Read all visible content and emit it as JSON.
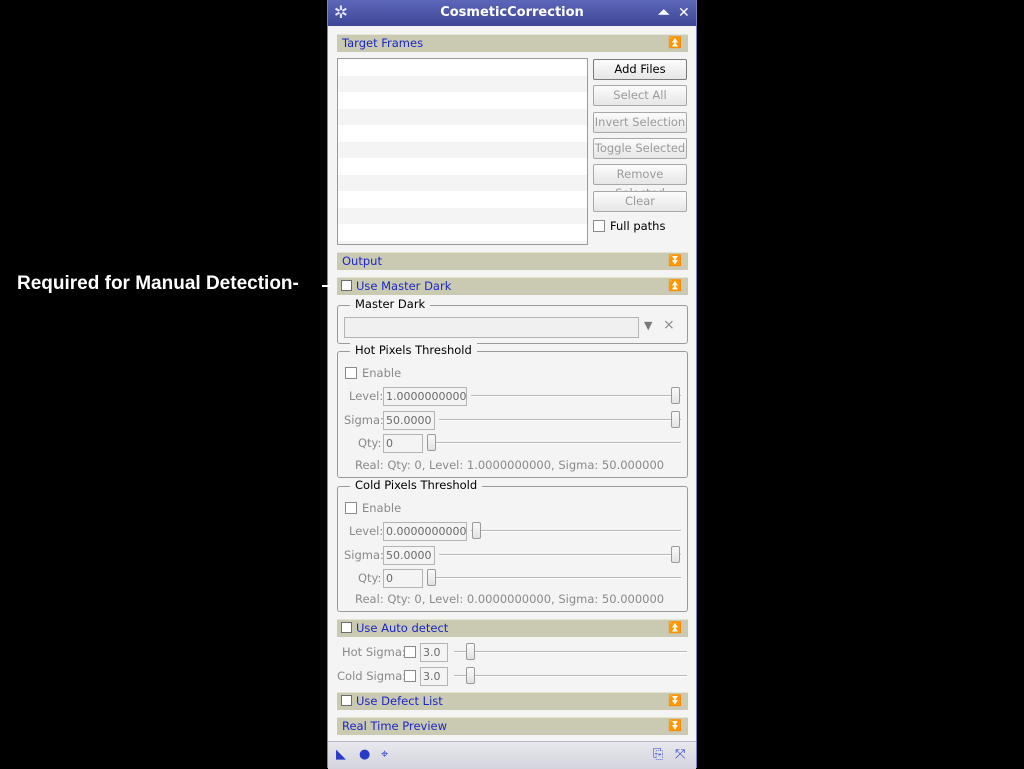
{
  "annotation": {
    "text": "Required for Manual Detection-"
  },
  "window": {
    "title": "CosmeticCorrection",
    "icons": {
      "menu": "gear-icon",
      "shade": "shade-up-icon",
      "close": "close-icon"
    }
  },
  "target_frames": {
    "header": "Target Frames",
    "buttons": {
      "add_files": "Add Files",
      "select_all": "Select All",
      "invert_selection": "Invert Selection",
      "toggle_selected": "Toggle Selected",
      "remove_selected": "Remove Selected",
      "clear": "Clear"
    },
    "full_paths": "Full paths"
  },
  "output": {
    "header": "Output"
  },
  "master_dark_section": {
    "header": "Use Master Dark",
    "master_dark_group": {
      "title": "Master Dark",
      "path_value": ""
    },
    "hot": {
      "title": "Hot Pixels Threshold",
      "enable": "Enable",
      "level_label": "Level:",
      "level_value": "1.0000000000",
      "level_slider": 1.0,
      "sigma_label": "Sigma:",
      "sigma_value": "50.0000",
      "sigma_slider": 1.0,
      "qty_label": "Qty:",
      "qty_value": "0",
      "qty_slider": 0.0,
      "real": "Real: Qty: 0, Level: 1.0000000000, Sigma: 50.000000"
    },
    "cold": {
      "title": "Cold Pixels Threshold",
      "enable": "Enable",
      "level_label": "Level:",
      "level_value": "0.0000000000",
      "level_slider": 0.0,
      "sigma_label": "Sigma:",
      "sigma_value": "50.0000",
      "sigma_slider": 1.0,
      "qty_label": "Qty:",
      "qty_value": "0",
      "qty_slider": 0.0,
      "real": "Real: Qty: 0, Level: 0.0000000000, Sigma: 50.000000"
    }
  },
  "auto_detect": {
    "header": "Use Auto detect",
    "hot_label": "Hot Sigma:",
    "hot_value": "3.0",
    "cold_label": "Cold Sigma:",
    "cold_value": "3.0"
  },
  "defect_list": {
    "header": "Use Defect List"
  },
  "real_time_preview": {
    "header": "Real Time Preview"
  }
}
